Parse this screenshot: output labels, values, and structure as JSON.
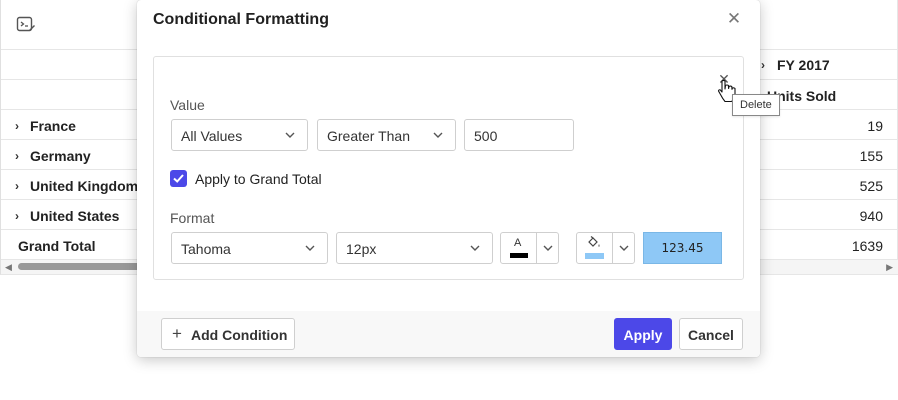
{
  "grid": {
    "column_header": "FY 2017",
    "measure_header": "Units Sold",
    "rows": [
      {
        "label": "France",
        "value": "19"
      },
      {
        "label": "Germany",
        "value": "155"
      },
      {
        "label": "United Kingdom",
        "value": "525"
      },
      {
        "label": "United States",
        "value": "940"
      }
    ],
    "grand_total": {
      "label": "Grand Total",
      "value": "1639"
    }
  },
  "dialog": {
    "title": "Conditional Formatting",
    "condition": {
      "value_label": "Value",
      "field": "All Values",
      "operator": "Greater Than",
      "threshold": "500",
      "apply_grand_total_label": "Apply to Grand Total",
      "apply_grand_total_checked": true,
      "format_label": "Format",
      "font_family": "Tahoma",
      "font_size": "12px",
      "font_color_glyph": "A",
      "font_color": "#000000",
      "background_color": "#8ec8f6",
      "preview_text": "123.45",
      "delete_tooltip": "Delete"
    },
    "add_condition_label": "Add Condition",
    "apply_label": "Apply",
    "cancel_label": "Cancel"
  },
  "colors": {
    "accent": "#4c48e8",
    "preview_bg": "#8ec8f6"
  }
}
